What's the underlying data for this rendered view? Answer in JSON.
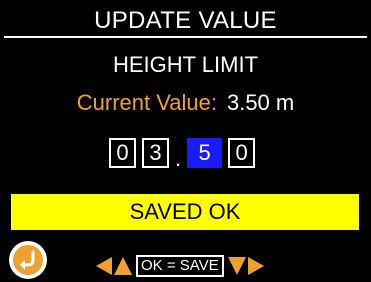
{
  "header": {
    "title": "UPDATE VALUE"
  },
  "parameter": {
    "name": "HEIGHT LIMIT"
  },
  "current": {
    "label": "Current Value:",
    "value": "3.50 m"
  },
  "editor": {
    "digits": [
      "0",
      "3",
      "5",
      "0"
    ],
    "selected_index": 2,
    "decimal_separator": "."
  },
  "status": {
    "text": "SAVED OK"
  },
  "footer": {
    "ok_label": "OK = SAVE"
  },
  "colors": {
    "accent": "#f0a030",
    "selection": "#1a1aff",
    "status_bg": "#ffff00"
  }
}
